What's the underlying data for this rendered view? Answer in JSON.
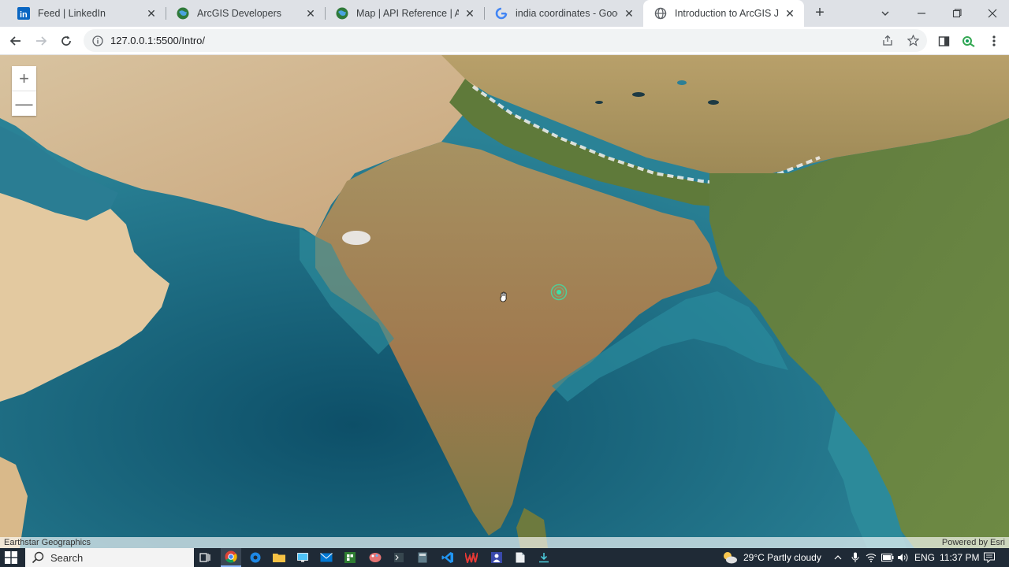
{
  "tabs": [
    {
      "title": "Feed | LinkedIn",
      "favicon": "linkedin-icon",
      "active": false
    },
    {
      "title": "ArcGIS Developers",
      "favicon": "globe-icon",
      "active": false
    },
    {
      "title": "Map | API Reference | ArcGIS",
      "favicon": "globe-icon",
      "active": false
    },
    {
      "title": "india coordinates - Google Search",
      "favicon": "google-icon",
      "active": false
    },
    {
      "title": "Introduction to ArcGIS JS API",
      "favicon": "world-icon",
      "active": true
    }
  ],
  "address_bar": {
    "url": "127.0.0.1:5500/Intro/"
  },
  "map": {
    "attribution_left": "Earthstar Geographics",
    "attribution_right": "Powered by Esri",
    "zoom_in": "+",
    "zoom_out": "—"
  },
  "taskbar": {
    "search_label": "Search",
    "weather": "29°C  Partly cloudy",
    "language": "ENG",
    "time": "11:37 PM"
  },
  "colors": {
    "tab_strip": "#dee1e6",
    "ocean": "#1f6f86",
    "land": "#a88a5a",
    "marker": "#3fe0a8",
    "taskbar": "#1f2a36"
  }
}
